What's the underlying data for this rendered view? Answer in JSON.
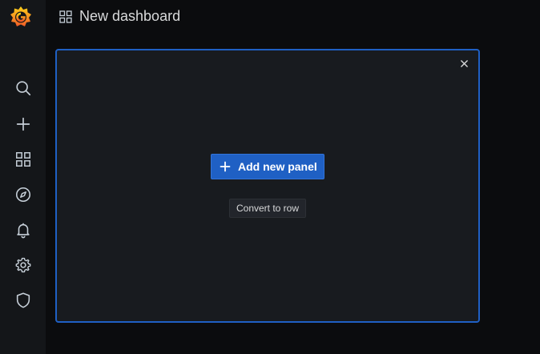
{
  "app": {
    "logo_icon": "grafana-logo-icon"
  },
  "sidemenu": {
    "items": [
      {
        "name": "search",
        "icon": "search-icon"
      },
      {
        "name": "create",
        "icon": "plus-icon"
      },
      {
        "name": "dashboards",
        "icon": "apps-grid-icon"
      },
      {
        "name": "explore",
        "icon": "compass-icon"
      },
      {
        "name": "alerting",
        "icon": "bell-icon"
      },
      {
        "name": "configuration",
        "icon": "gear-icon"
      },
      {
        "name": "server-admin",
        "icon": "shield-icon"
      }
    ]
  },
  "header": {
    "icon": "apps-grid-icon",
    "title": "New dashboard"
  },
  "panel": {
    "add_panel_label": "Add new panel",
    "convert_label": "Convert to row",
    "close_icon": "close-icon"
  },
  "colors": {
    "background": "#0b0c0e",
    "sidemenu": "#141619",
    "panel": "#181b1f",
    "accent": "#1f60c4",
    "text": "#d8d9da",
    "icon": "#c7d0d9"
  }
}
